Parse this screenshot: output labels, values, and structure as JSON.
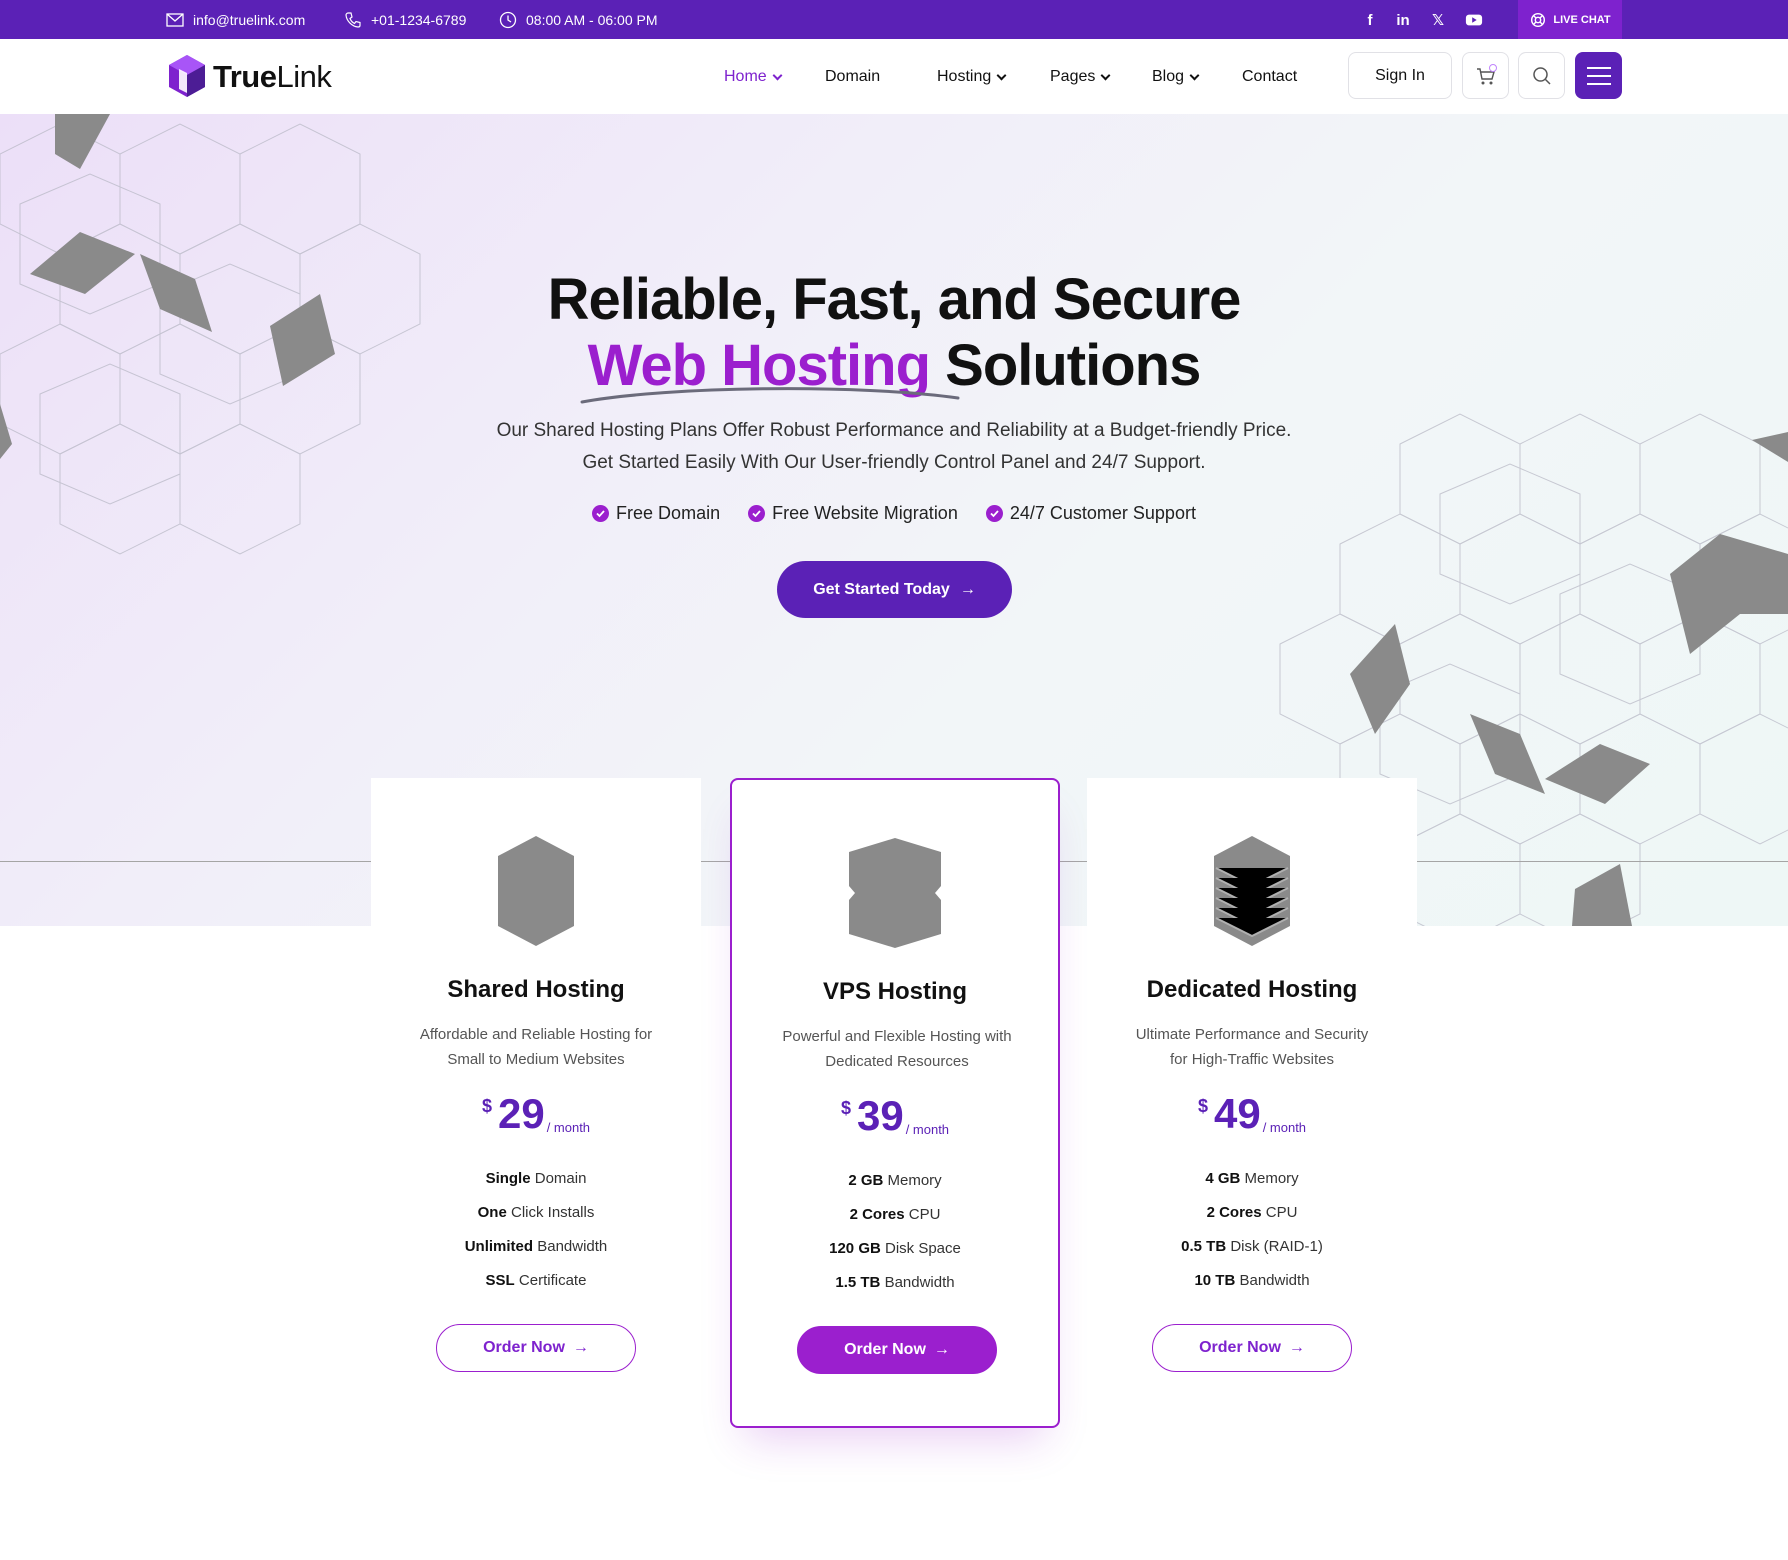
{
  "topbar": {
    "email": "info@truelink.com",
    "phone": "+01-1234-6789",
    "hours": "08:00 AM - 06:00 PM",
    "social_icons": [
      "facebook-icon",
      "linkedin-icon",
      "x-icon",
      "youtube-icon"
    ],
    "livechat_label": "LIVE CHAT",
    "background": "#5b21b6"
  },
  "header": {
    "logo_bold": "True",
    "logo_light": "Link",
    "nav": {
      "home": "Home",
      "domain": "Domain",
      "hosting": "Hosting",
      "pages": "Pages",
      "blog": "Blog",
      "contact": "Contact"
    },
    "signin_label": "Sign In",
    "cart_count": "0"
  },
  "hero": {
    "title_line1": "Reliable, Fast, and Secure",
    "title_accent": "Web Hosting",
    "title_rest": "Solutions",
    "desc_line1": "Our Shared Hosting Plans Offer Robust Performance and Reliability at a Budget-friendly Price.",
    "desc_line2": "Get Started Easily With Our User-friendly Control Panel and 24/7 Support.",
    "features": [
      "Free Domain",
      "Free Website Migration",
      "24/7 Customer Support"
    ],
    "cta_label": "Get Started Today",
    "accent_color": "#9b1fce"
  },
  "plans": [
    {
      "icon": "shared-server-icon",
      "title": "Shared Hosting",
      "sub_line1": "Affordable and Reliable Hosting for",
      "sub_line2": "Small to Medium Websites",
      "currency": "$",
      "price": "29",
      "period": "/ month",
      "features": [
        {
          "bold": "Single",
          "text": "Domain"
        },
        {
          "bold": "One",
          "text": "Click Installs"
        },
        {
          "bold": "Unlimited",
          "text": "Bandwidth"
        },
        {
          "bold": "SSL",
          "text": "Certificate"
        }
      ],
      "button": "Order Now"
    },
    {
      "icon": "vps-server-icon",
      "title": "VPS Hosting",
      "sub_line1": "Powerful and Flexible Hosting with",
      "sub_line2": "Dedicated Resources",
      "currency": "$",
      "price": "39",
      "period": "/ month",
      "features": [
        {
          "bold": "2 GB",
          "text": "Memory"
        },
        {
          "bold": "2 Cores",
          "text": "CPU"
        },
        {
          "bold": "120 GB",
          "text": "Disk Space"
        },
        {
          "bold": "1.5 TB",
          "text": "Bandwidth"
        }
      ],
      "button": "Order Now"
    },
    {
      "icon": "dedicated-server-icon",
      "title": "Dedicated Hosting",
      "sub_line1": "Ultimate Performance and Security",
      "sub_line2": "for High-Traffic Websites",
      "currency": "$",
      "price": "49",
      "period": "/ month",
      "features": [
        {
          "bold": "4 GB",
          "text": "Memory"
        },
        {
          "bold": "2 Cores",
          "text": "CPU"
        },
        {
          "bold": "0.5 TB",
          "text": "Disk (RAID-1)"
        },
        {
          "bold": "10 TB",
          "text": "Bandwidth"
        }
      ],
      "button": "Order Now"
    }
  ]
}
